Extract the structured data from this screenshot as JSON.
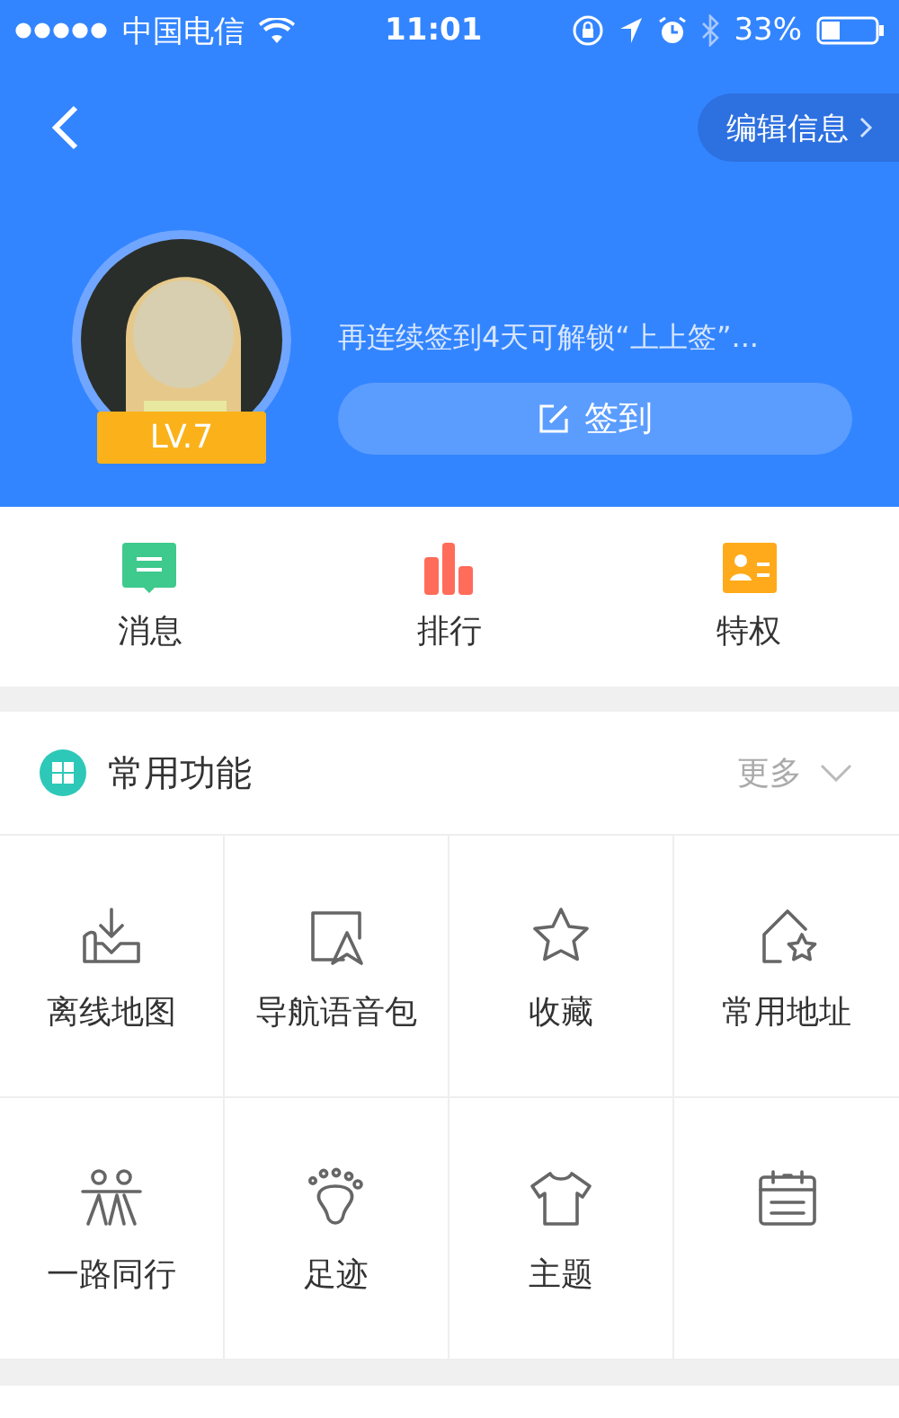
{
  "status_bar": {
    "carrier": "中国电信",
    "time": "11:01",
    "battery": "33%"
  },
  "header": {
    "edit_button": "编辑信息",
    "level": "LV.7",
    "sign_hint": "再连续签到4天可解锁“上上签”...",
    "sign_button": "签到"
  },
  "quick_actions": [
    {
      "kind": "message",
      "label": "消息"
    },
    {
      "kind": "rank",
      "label": "排行"
    },
    {
      "kind": "privilege",
      "label": "特权"
    }
  ],
  "section": {
    "title": "常用功能",
    "more": "更多"
  },
  "features": [
    {
      "kind": "offline-map",
      "label": "离线地图"
    },
    {
      "kind": "voice",
      "label": "导航语音包"
    },
    {
      "kind": "star",
      "label": "收藏"
    },
    {
      "kind": "home",
      "label": "常用地址"
    },
    {
      "kind": "people",
      "label": "一路同行"
    },
    {
      "kind": "foot",
      "label": "足迹"
    },
    {
      "kind": "shirt",
      "label": "主题"
    },
    {
      "kind": "calendar"
    }
  ]
}
